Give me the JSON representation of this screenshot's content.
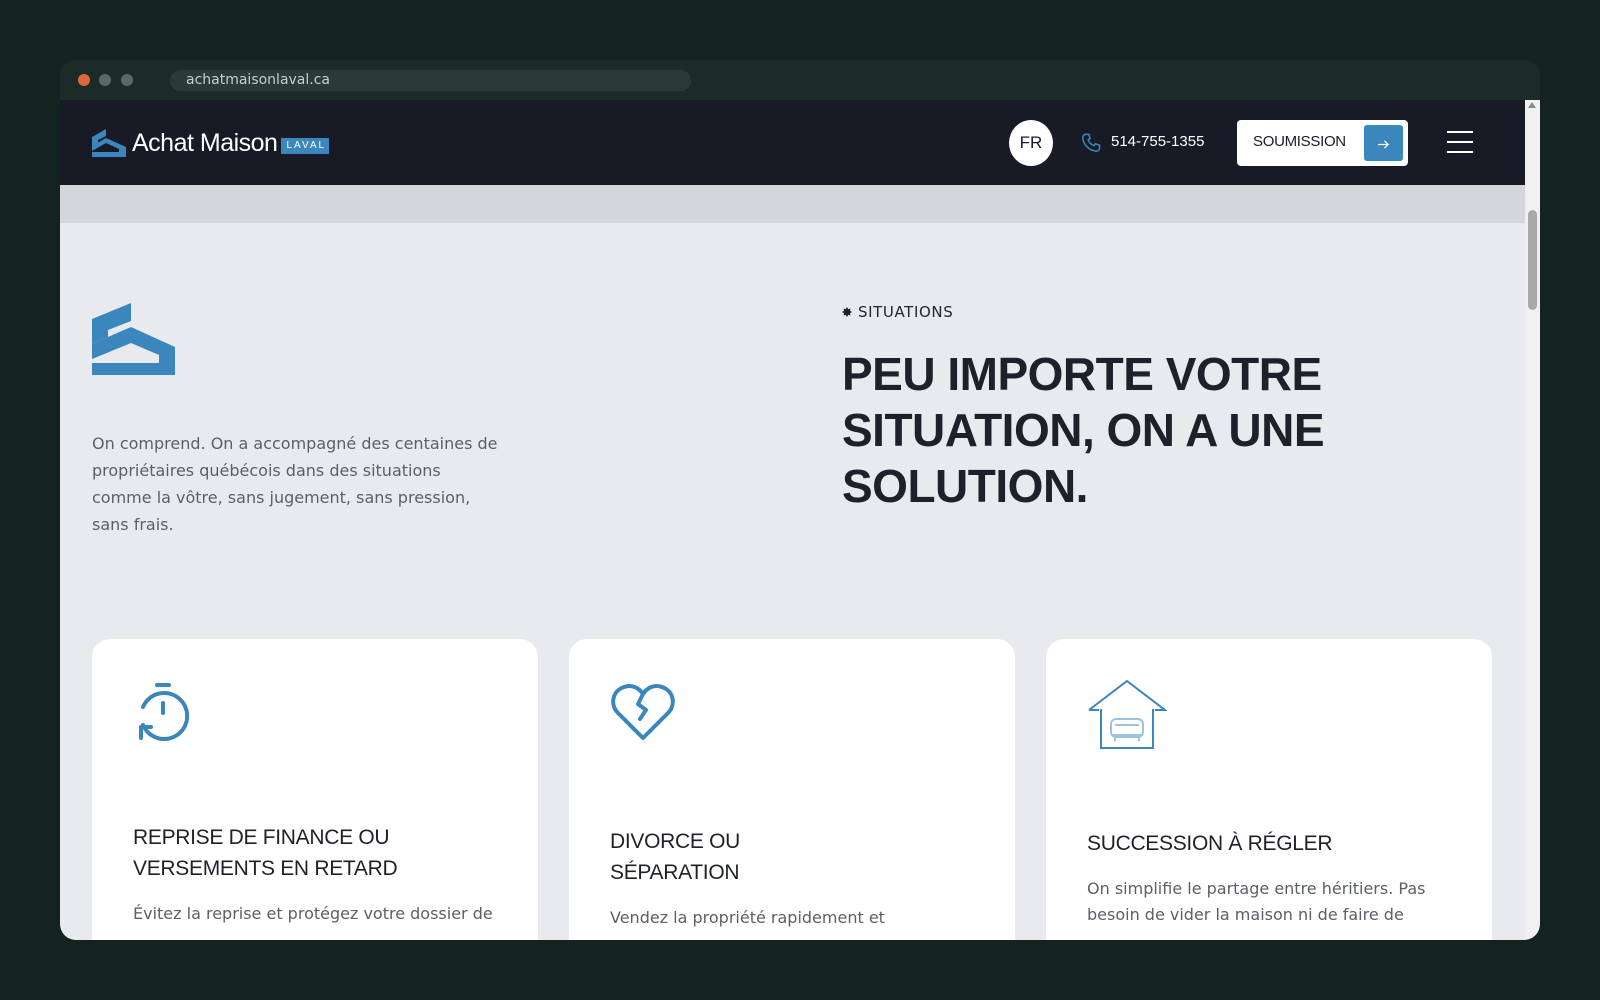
{
  "browser": {
    "url": "achatmaisonlaval.ca"
  },
  "colors": {
    "accent": "#3a86bd",
    "nav_bg": "#181b26",
    "page_bg": "#e8eaee",
    "card_bg": "#ffffff"
  },
  "nav": {
    "logo_text": "Achat Maison",
    "logo_badge": "LAVAL",
    "language": "FR",
    "phone": "514-755-1355",
    "quote_label": "SOUMISSION",
    "quote_icon": "arrow-right-icon",
    "menu_icon": "hamburger-icon"
  },
  "section": {
    "eyebrow": "SITUATIONS",
    "headline": "PEU IMPORTE VOTRE SITUATION, ON A UNE SOLUTION.",
    "intro": "On comprend. On a accompagné des centaines de propriétaires québécois dans des situations comme la vôtre, sans jugement, sans pression, sans frais."
  },
  "cards": [
    {
      "icon": "timer-refresh-icon",
      "title": "REPRISE DE FINANCE OU VERSEMENTS EN RETARD",
      "text": "Évitez la reprise et protégez votre dossier de"
    },
    {
      "icon": "broken-heart-icon",
      "title": "DIVORCE OU SÉPARATION",
      "text": "Vendez la propriété rapidement et"
    },
    {
      "icon": "house-sofa-icon",
      "title": "SUCCESSION À RÉGLER",
      "text": "On simplifie le partage entre héritiers. Pas besoin de vider la maison ni de faire de"
    }
  ]
}
